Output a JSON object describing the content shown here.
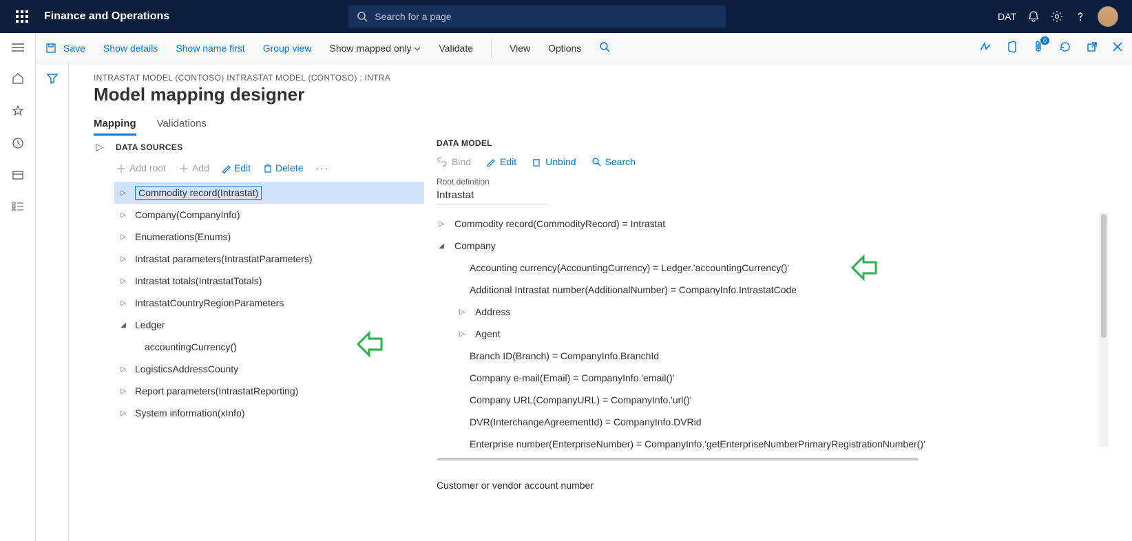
{
  "header": {
    "appTitle": "Finance and Operations",
    "searchPlaceholder": "Search for a page",
    "company": "DAT"
  },
  "actionBar": {
    "save": "Save",
    "showDetails": "Show details",
    "showNameFirst": "Show name first",
    "groupView": "Group view",
    "showMapped": "Show mapped only",
    "validate": "Validate",
    "view": "View",
    "options": "Options"
  },
  "page": {
    "breadcrumb": "INTRASTAT MODEL (CONTOSO) INTRASTAT MODEL (CONTOSO) : INTRA",
    "title": "Model mapping designer",
    "tabs": {
      "mapping": "Mapping",
      "validations": "Validations"
    }
  },
  "ds": {
    "heading": "DATA SOURCES",
    "addRoot": "Add root",
    "add": "Add",
    "edit": "Edit",
    "delete": "Delete",
    "nodes": {
      "commodity": "Commodity record(Intrastat)",
      "company": "Company(CompanyInfo)",
      "enums": "Enumerations(Enums)",
      "params": "Intrastat parameters(IntrastatParameters)",
      "totals": "Intrastat totals(IntrastatTotals)",
      "country": "IntrastatCountryRegionParameters",
      "ledger": "Ledger",
      "ledgerChild": "accountingCurrency()",
      "logistics": "LogisticsAddressCounty",
      "report": "Report parameters(IntrastatReporting)",
      "sysinfo": "System information(xInfo)"
    }
  },
  "dm": {
    "heading": "DATA MODEL",
    "bind": "Bind",
    "edit": "Edit",
    "unbind": "Unbind",
    "search": "Search",
    "rootDefLabel": "Root definition",
    "rootDefValue": "Intrastat",
    "nodes": {
      "commodity": "Commodity record(CommodityRecord) = Intrastat",
      "company": "Company",
      "acctCur": "Accounting currency(AccountingCurrency) = Ledger.'accountingCurrency()'",
      "addIntra": "Additional Intrastat number(AdditionalNumber) = CompanyInfo.IntrastatCode",
      "address": "Address",
      "agent": "Agent",
      "branch": "Branch ID(Branch) = CompanyInfo.BranchId",
      "email": "Company e-mail(Email) = CompanyInfo.'email()'",
      "url": "Company URL(CompanyURL) = CompanyInfo.'url()'",
      "dvr": "DVR(InterchangeAgreementId) = CompanyInfo.DVRid",
      "ent": "Enterprise number(EnterpriseNumber) = CompanyInfo.'getEnterpriseNumberPrimaryRegistrationNumber()'"
    },
    "footnote": "Customer or vendor account number"
  }
}
